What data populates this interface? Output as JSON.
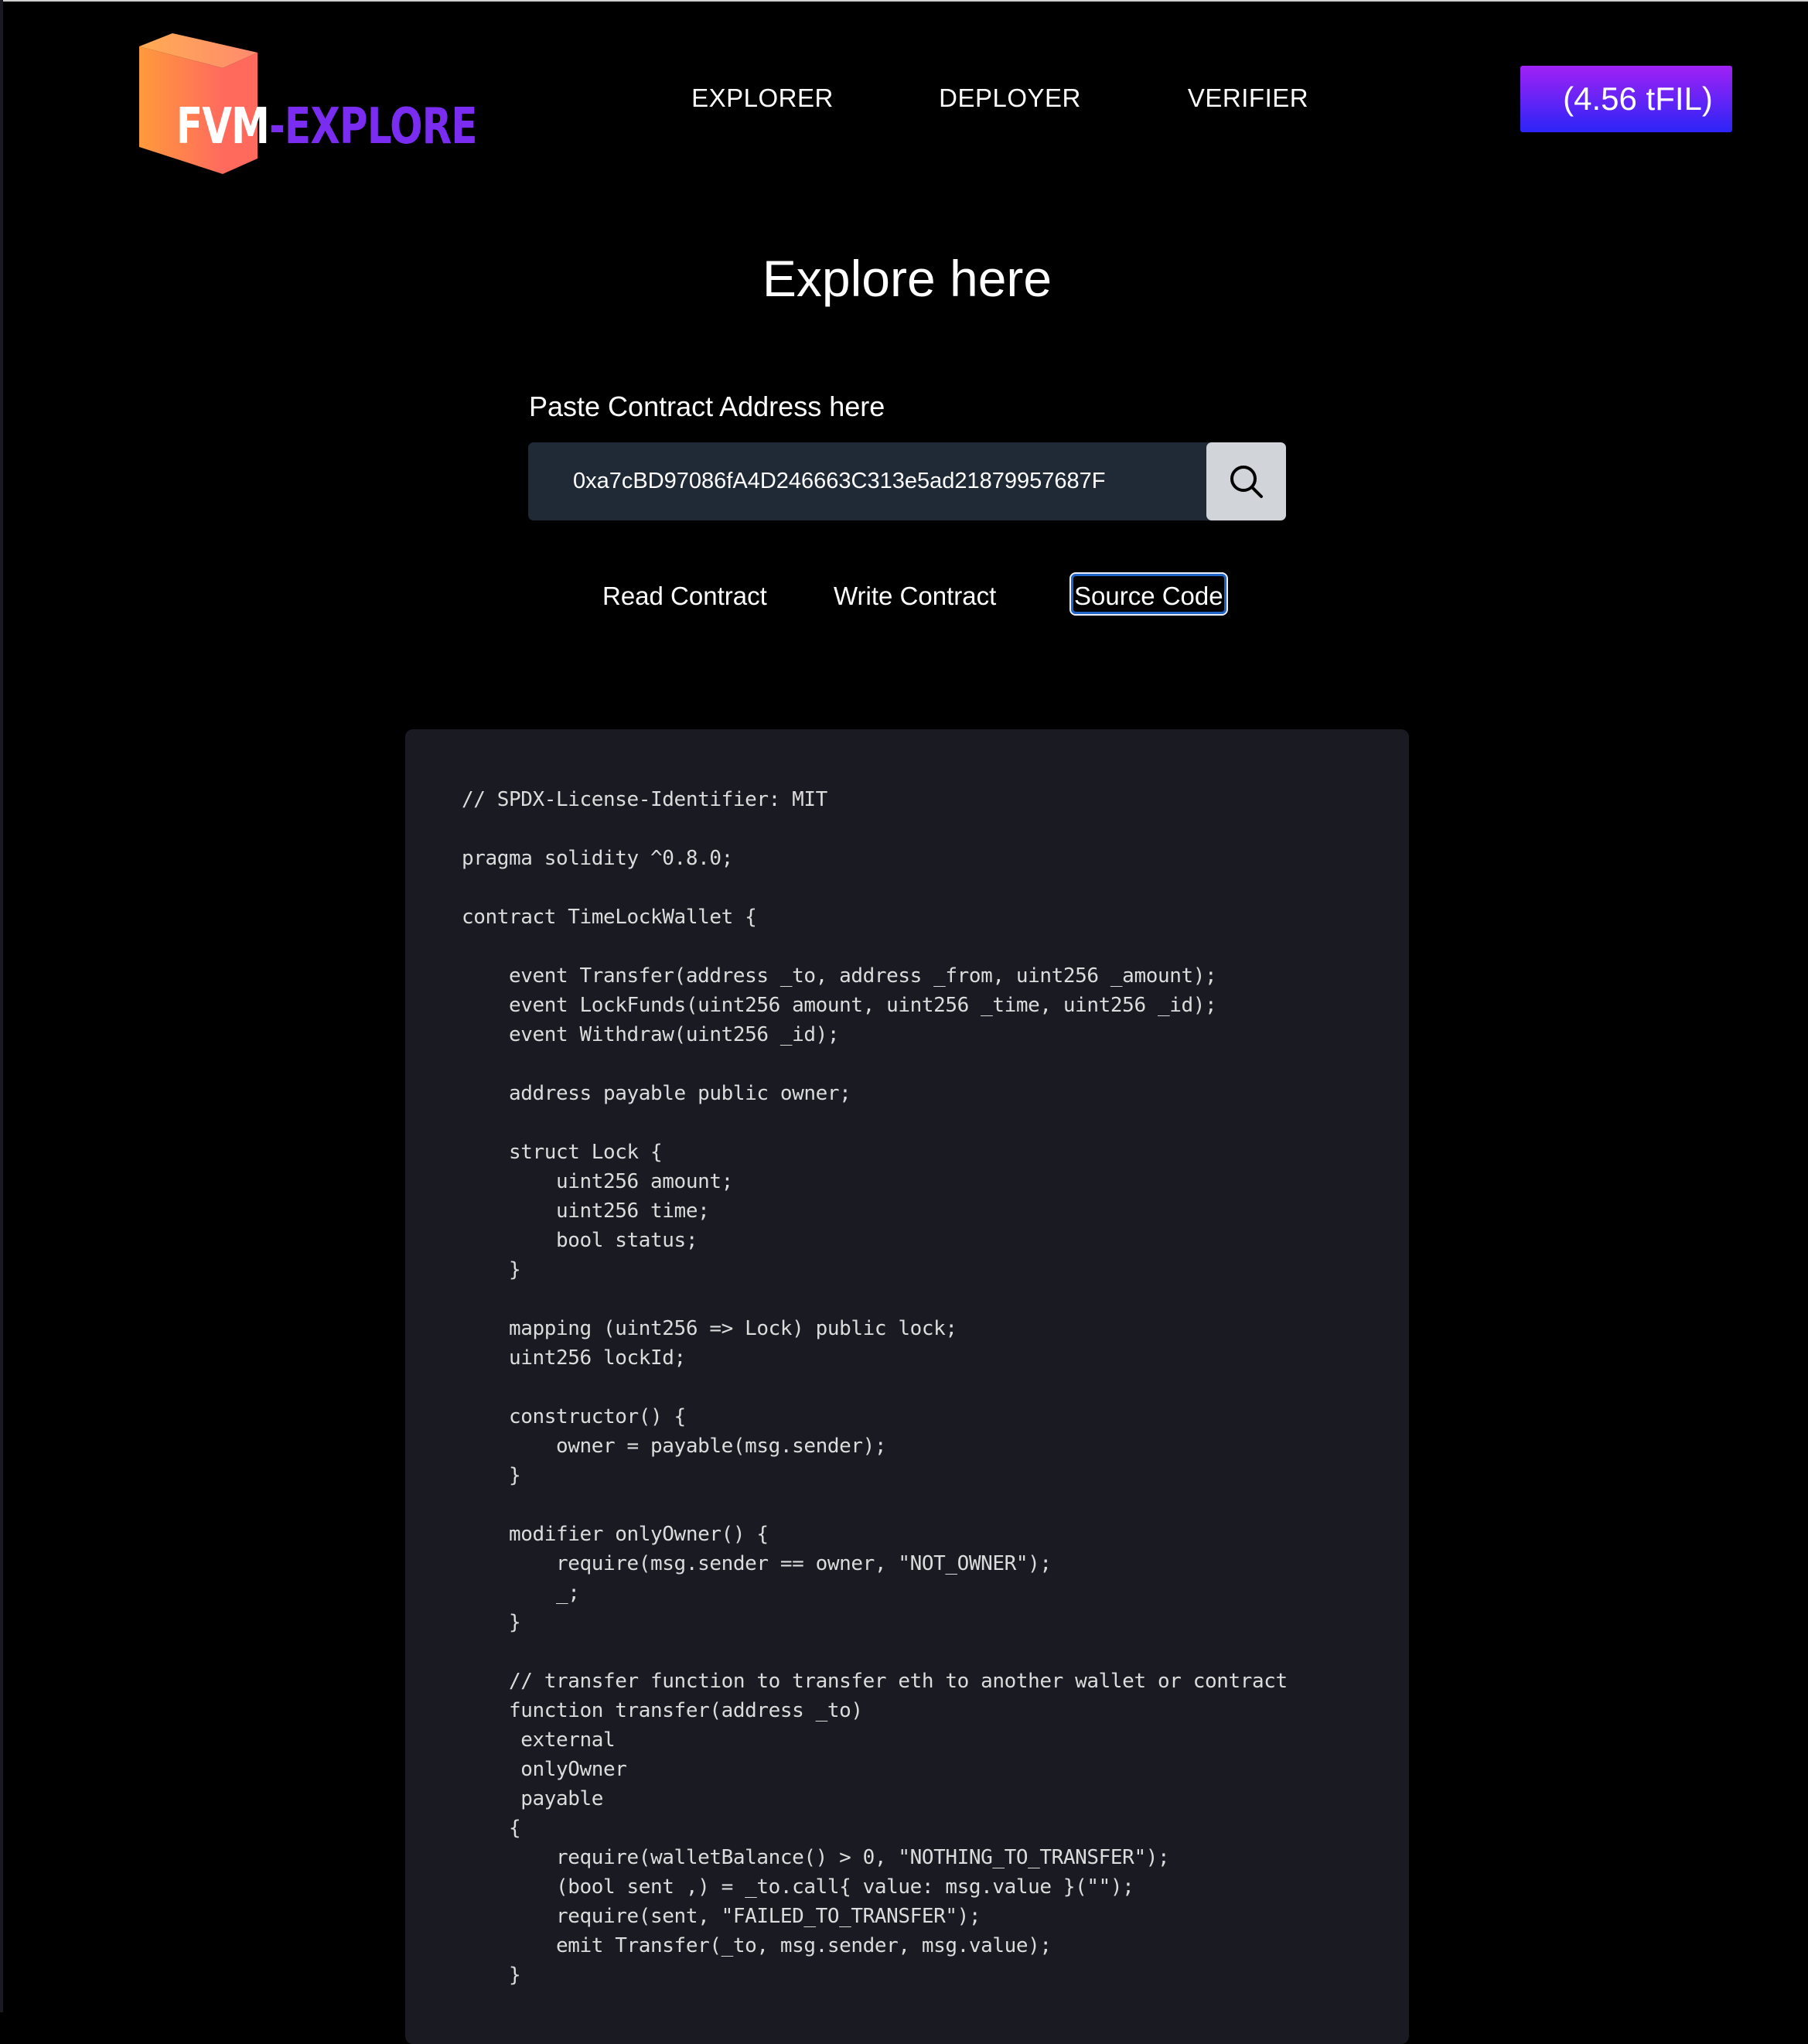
{
  "logo": {
    "part1": "FVM",
    "part2": "-EXPLORE"
  },
  "nav": {
    "items": [
      {
        "label": "EXPLORER"
      },
      {
        "label": "DEPLOYER"
      },
      {
        "label": "VERIFIER"
      }
    ],
    "balance_label": "(4.56 tFIL)"
  },
  "page": {
    "title": "Explore here",
    "address_label": "Paste Contract Address here",
    "address_value": "0xa7cBD97086fA4D246663C313e5ad21879957687F",
    "search_icon": "search-icon"
  },
  "tabs": [
    {
      "label": "Read Contract",
      "active": false
    },
    {
      "label": "Write Contract",
      "active": false
    },
    {
      "label": "Source Code",
      "active": true
    }
  ],
  "colors": {
    "background": "#000000",
    "input_bg": "#202a37",
    "search_bg": "#d1d5d9",
    "code_bg": "#1a1a23",
    "accent_gradient_top": "#a122f5",
    "accent_gradient_bottom": "#2b25f6",
    "logo_purple": "#7a2cf0",
    "logo_orange": "#ff9a3c"
  },
  "source_code": {
    "lines": [
      "// SPDX-License-Identifier: MIT",
      "",
      "pragma solidity ^0.8.0;",
      "",
      "contract TimeLockWallet {",
      "",
      "    event Transfer(address _to, address _from, uint256 _amount);",
      "    event LockFunds(uint256 amount, uint256 _time, uint256 _id);",
      "    event Withdraw(uint256 _id);",
      "",
      "    address payable public owner;",
      "",
      "    struct Lock {",
      "        uint256 amount;",
      "        uint256 time;",
      "        bool status;",
      "    }",
      "",
      "    mapping (uint256 => Lock) public lock;",
      "    uint256 lockId;",
      "",
      "    constructor() {",
      "        owner = payable(msg.sender);",
      "    }",
      "",
      "    modifier onlyOwner() {",
      "        require(msg.sender == owner, \"NOT_OWNER\");",
      "        _;",
      "    }",
      "",
      "    // transfer function to transfer eth to another wallet or contract",
      "    function transfer(address _to)",
      "     external",
      "     onlyOwner",
      "     payable",
      "    {",
      "        require(walletBalance() > 0, \"NOTHING_TO_TRANSFER\");",
      "        (bool sent ,) = _to.call{ value: msg.value }(\"\");",
      "        require(sent, \"FAILED_TO_TRANSFER\");",
      "        emit Transfer(_to, msg.sender, msg.value);",
      "    }"
    ]
  }
}
